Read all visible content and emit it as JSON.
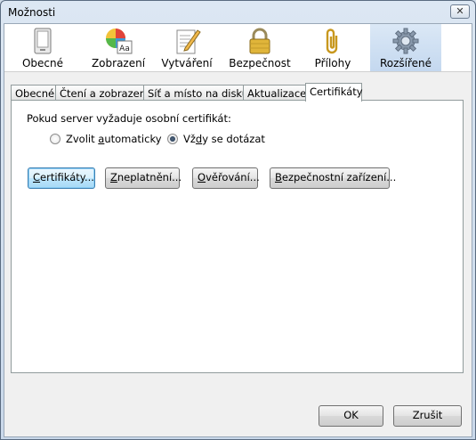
{
  "window": {
    "title": "Možnosti",
    "close_symbol": "✕"
  },
  "toolbar": {
    "panes": [
      {
        "label": "Obecné",
        "icon": "general-icon"
      },
      {
        "label": "Zobrazení",
        "icon": "display-icon"
      },
      {
        "label": "Vytváření",
        "icon": "compose-icon"
      },
      {
        "label": "Bezpečnost",
        "icon": "lock-icon"
      },
      {
        "label": "Přílohy",
        "icon": "paperclip-icon"
      },
      {
        "label": "Rozšířené",
        "icon": "gear-icon"
      }
    ],
    "selected": "Rozšířené"
  },
  "tabs": [
    "Obecné",
    "Čtení a zobrazení",
    "Síť a místo na disku",
    "Aktualizace",
    "Certifikáty"
  ],
  "active_tab": "Certifikáty",
  "certs": {
    "question": "Pokud server vyžaduje osobní certifikát:",
    "option_auto": "Zvolit automaticky",
    "option_ask": "Vždy se dotázat",
    "selected_option": "Vždy se dotázat",
    "btn_certificates": "Certifikáty...",
    "btn_revocation": "Zneplatnění...",
    "btn_validation": "Ověřování...",
    "btn_devices": "Bezpečnostní zařízení..."
  },
  "dialog": {
    "ok": "OK",
    "cancel": "Zrušit"
  }
}
